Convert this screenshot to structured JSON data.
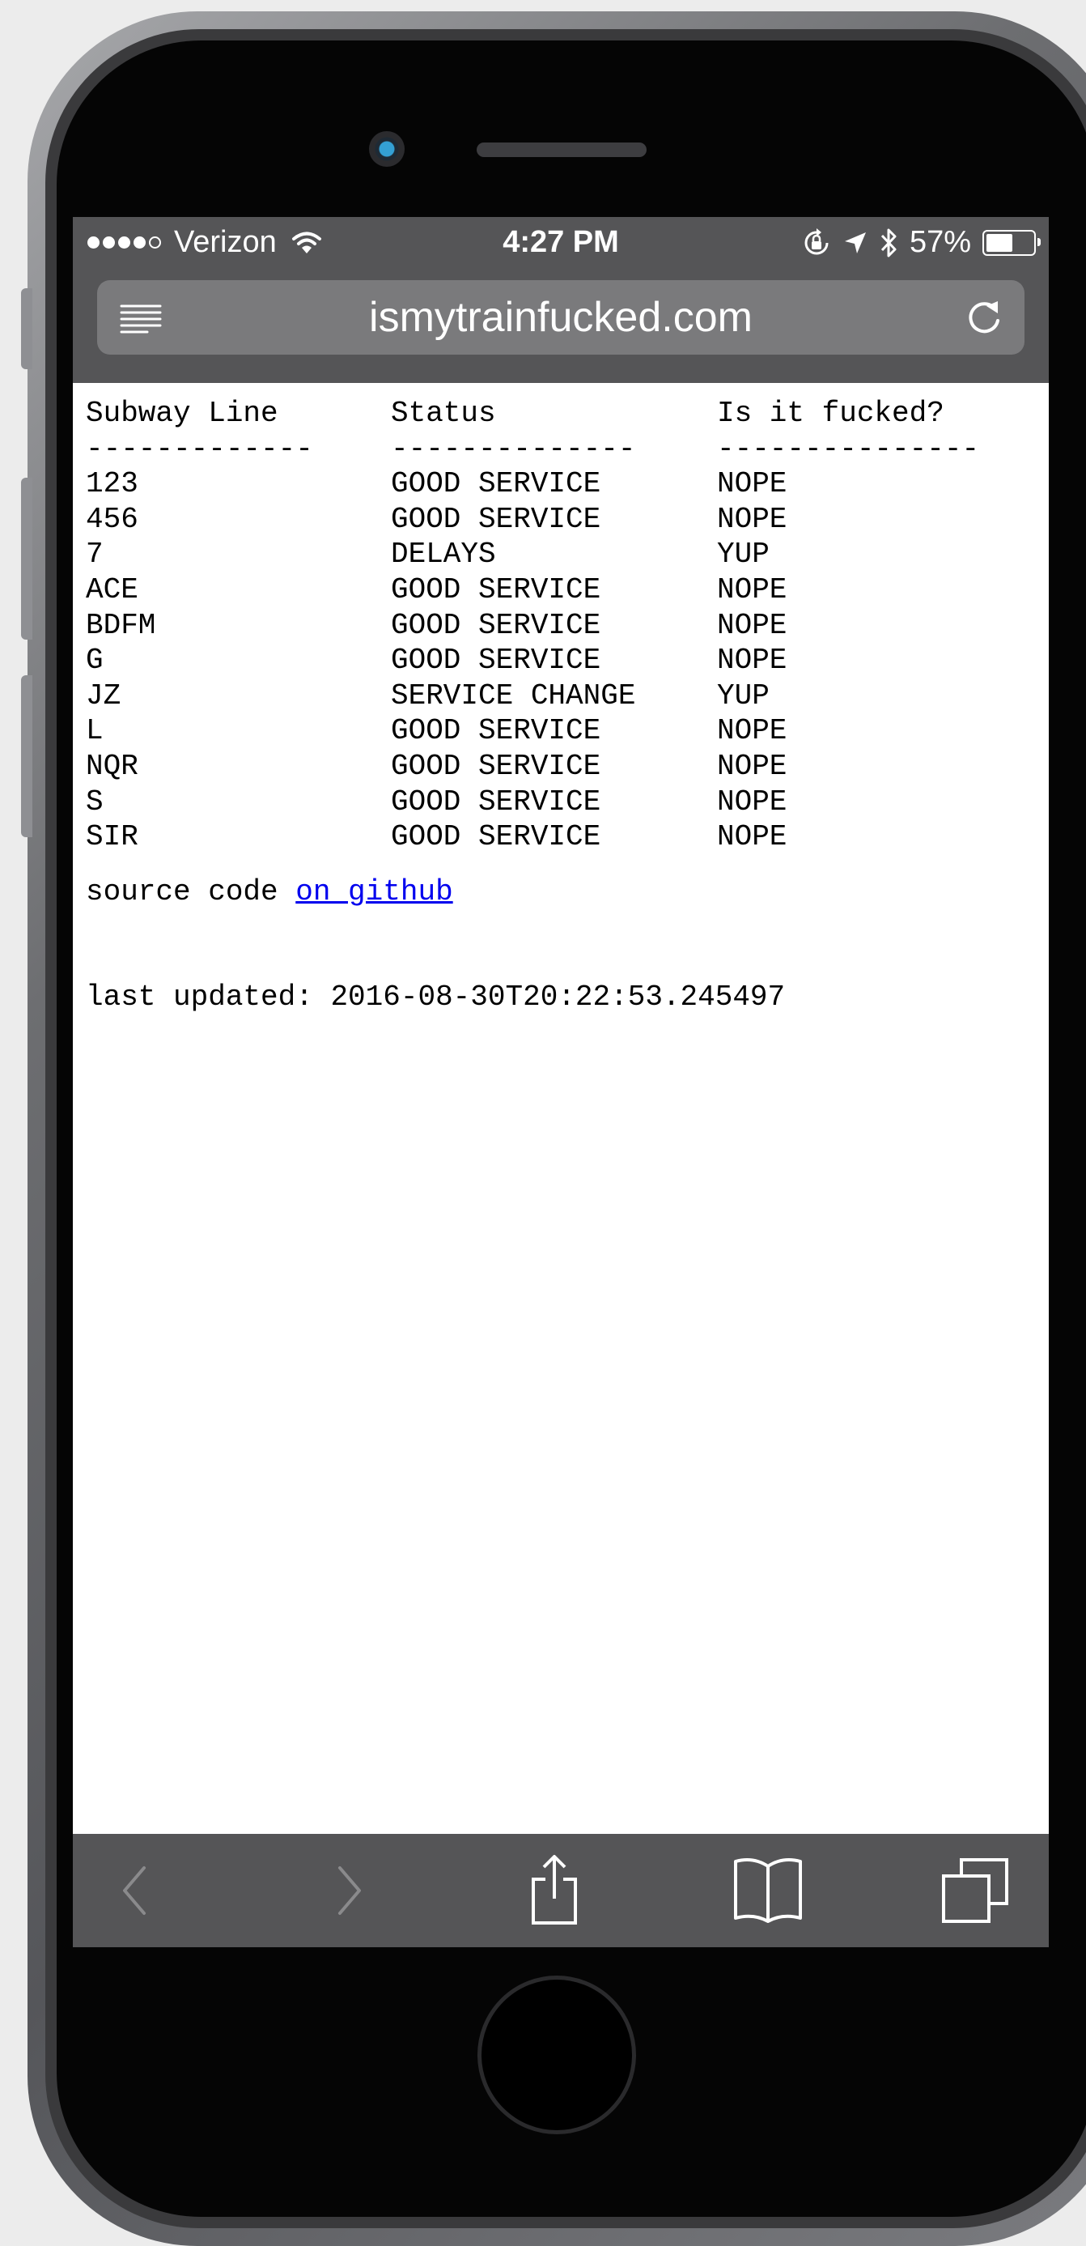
{
  "status_bar": {
    "carrier": "Verizon",
    "time": "4:27 PM",
    "battery": "57%",
    "battery_level": 0.57
  },
  "browser": {
    "url": "ismytrainfucked.com"
  },
  "page": {
    "headers": [
      "Subway Line",
      "Status",
      "Is it fucked?"
    ],
    "dividers": [
      "-------------",
      "--------------",
      "---------------"
    ],
    "rows": [
      [
        "123",
        "GOOD SERVICE",
        "NOPE"
      ],
      [
        "456",
        "GOOD SERVICE",
        "NOPE"
      ],
      [
        "7",
        "DELAYS",
        "YUP"
      ],
      [
        "ACE",
        "GOOD SERVICE",
        "NOPE"
      ],
      [
        "BDFM",
        "GOOD SERVICE",
        "NOPE"
      ],
      [
        "G",
        "GOOD SERVICE",
        "NOPE"
      ],
      [
        "JZ",
        "SERVICE CHANGE",
        "YUP"
      ],
      [
        "L",
        "GOOD SERVICE",
        "NOPE"
      ],
      [
        "NQR",
        "GOOD SERVICE",
        "NOPE"
      ],
      [
        "S",
        "GOOD SERVICE",
        "NOPE"
      ],
      [
        "SIR",
        "GOOD SERVICE",
        "NOPE"
      ]
    ],
    "source_prefix": "source code ",
    "source_link": "on github",
    "last_updated": "last updated: 2016-08-30T20:22:53.245497"
  },
  "icons": {
    "reader": "reader-mode-icon",
    "reload": "reload-icon",
    "back": "back-chevron-icon",
    "forward": "forward-chevron-icon",
    "share": "share-icon",
    "bookmarks": "bookmarks-icon",
    "tabs": "tabs-icon"
  },
  "colors": {
    "chrome": "#555557",
    "link": "#0000ee"
  }
}
